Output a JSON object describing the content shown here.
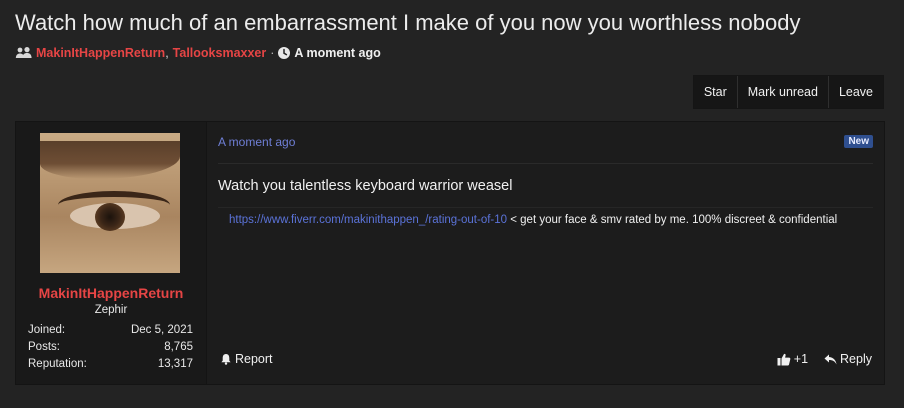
{
  "thread": {
    "title": "Watch how much of an embarrassment I make of you now you worthless nobody",
    "participants": [
      "MakinItHappenReturn",
      "Tallooksmaxxer"
    ],
    "separator": "·",
    "time": "A moment ago"
  },
  "actions": {
    "star": "Star",
    "mark_unread": "Mark unread",
    "leave": "Leave"
  },
  "post": {
    "time": "A moment ago",
    "badge": "New",
    "body": "Watch you talentless keyboard warrior weasel",
    "signature": {
      "link": "https://www.fiverr.com/makinithappen_/rating-out-of-10",
      "text": " < get your face & smv rated by me. 100% discreet & confidential"
    },
    "report": "Report",
    "like_count": "+1",
    "reply": "Reply"
  },
  "author": {
    "username": "MakinItHappenReturn",
    "user_title": "Zephir",
    "stats": [
      {
        "key": "Joined:",
        "value": "Dec 5, 2021"
      },
      {
        "key": "Posts:",
        "value": "8,765"
      },
      {
        "key": "Reputation:",
        "value": "13,317"
      }
    ]
  },
  "colors": {
    "username": "#e64545",
    "link": "#5b73d9",
    "time": "#6f7fd6",
    "badge_bg": "#2f4f8f",
    "background": "#232323"
  },
  "icons": {
    "participants": "users-icon",
    "time": "clock-icon",
    "report": "bell-icon",
    "like": "thumbs-up-icon",
    "reply": "reply-arrow-icon"
  }
}
